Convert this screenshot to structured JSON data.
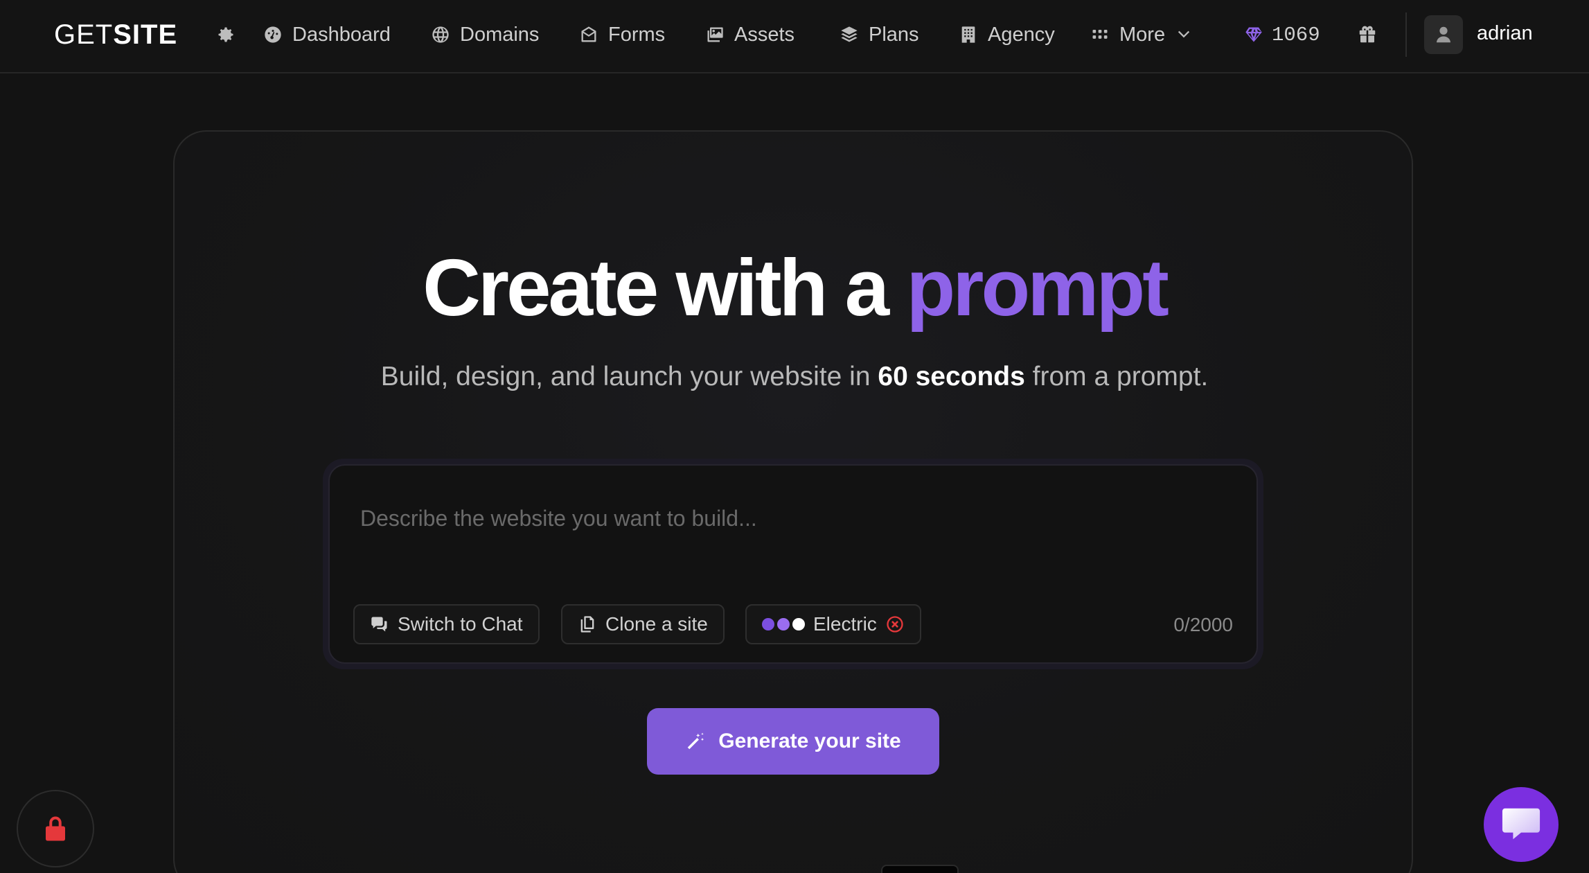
{
  "brand": {
    "logo_light": "GET",
    "logo_bold": "SITE"
  },
  "nav": {
    "settings_icon": "gear-icon",
    "items": [
      {
        "label": "Dashboard",
        "icon": "dashboard-gauge-icon"
      },
      {
        "label": "Domains",
        "icon": "globe-icon"
      },
      {
        "label": "Forms",
        "icon": "envelope-open-icon"
      },
      {
        "label": "Assets",
        "icon": "images-icon"
      },
      {
        "label": "Plans",
        "icon": "layers-icon"
      },
      {
        "label": "Agency",
        "icon": "building-icon"
      },
      {
        "label": "More",
        "icon": "grid-dots-icon"
      }
    ],
    "gems": "1069",
    "gift_icon": "gift-icon",
    "username": "adrian"
  },
  "hero": {
    "title_main": "Create with a",
    "title_accent": "prompt",
    "subtitle_pre": "Build, design, and launch your website in",
    "subtitle_bold": "60 seconds",
    "subtitle_post": "from a prompt."
  },
  "prompt": {
    "placeholder": "Describe the website you want to build...",
    "value": "",
    "switch_label": "Switch to Chat",
    "clone_label": "Clone a site",
    "theme_label": "Electric",
    "theme_colors": [
      "#7b4fe0",
      "#9a6df0",
      "#ffffff"
    ],
    "counter": "0/2000"
  },
  "cta": {
    "generate_label": "Generate your site"
  },
  "colors": {
    "accent": "#8e63e8",
    "button": "#7f5ad8",
    "lock": "#e5383b",
    "chat": "#7b2fe0",
    "background": "#131313"
  }
}
